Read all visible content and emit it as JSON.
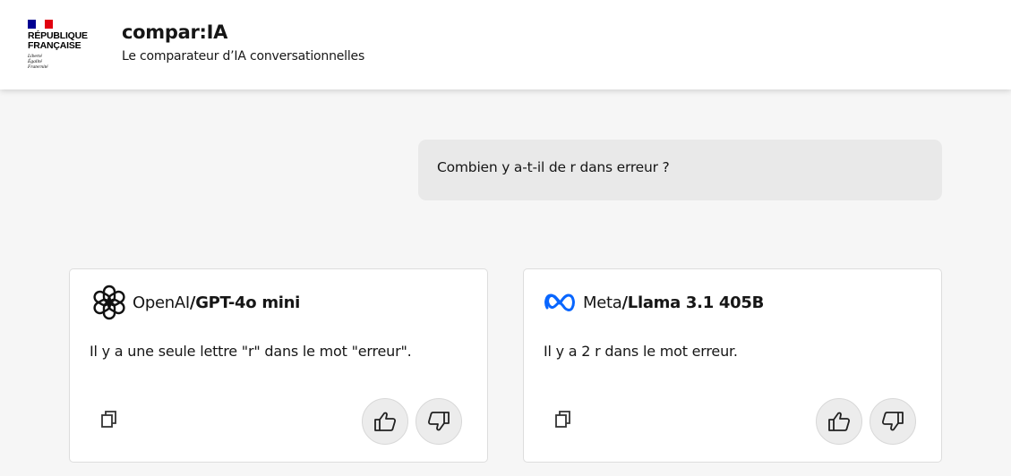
{
  "logo": {
    "line1": "RÉPUBLIQUE",
    "line2": "FRANÇAISE",
    "motto1": "Liberté",
    "motto2": "Égalité",
    "motto3": "Fraternité",
    "flag_colors": [
      "#000091",
      "#ffffff",
      "#e1000f"
    ]
  },
  "header": {
    "title": "compar:IA",
    "subtitle": "Le comparateur d’IA conversationnelles"
  },
  "conversation": {
    "user_message": "Combien y a-t-il de r dans erreur ?"
  },
  "models": [
    {
      "provider": "OpenAI",
      "separator": "/",
      "model": "GPT-4o mini",
      "icon": "openai-icon",
      "answer": "Il y a une seule lettre \"r\" dans le mot \"erreur\"."
    },
    {
      "provider": "Meta",
      "separator": "/",
      "model": "Llama 3.1 405B",
      "icon": "meta-icon",
      "icon_color": "#0866ff",
      "answer": "Il y a 2 r dans le mot erreur."
    }
  ],
  "actions": {
    "copy_icon": "copy-icon",
    "like_icon": "thumbs-up-icon",
    "dislike_icon": "thumbs-down-icon"
  }
}
